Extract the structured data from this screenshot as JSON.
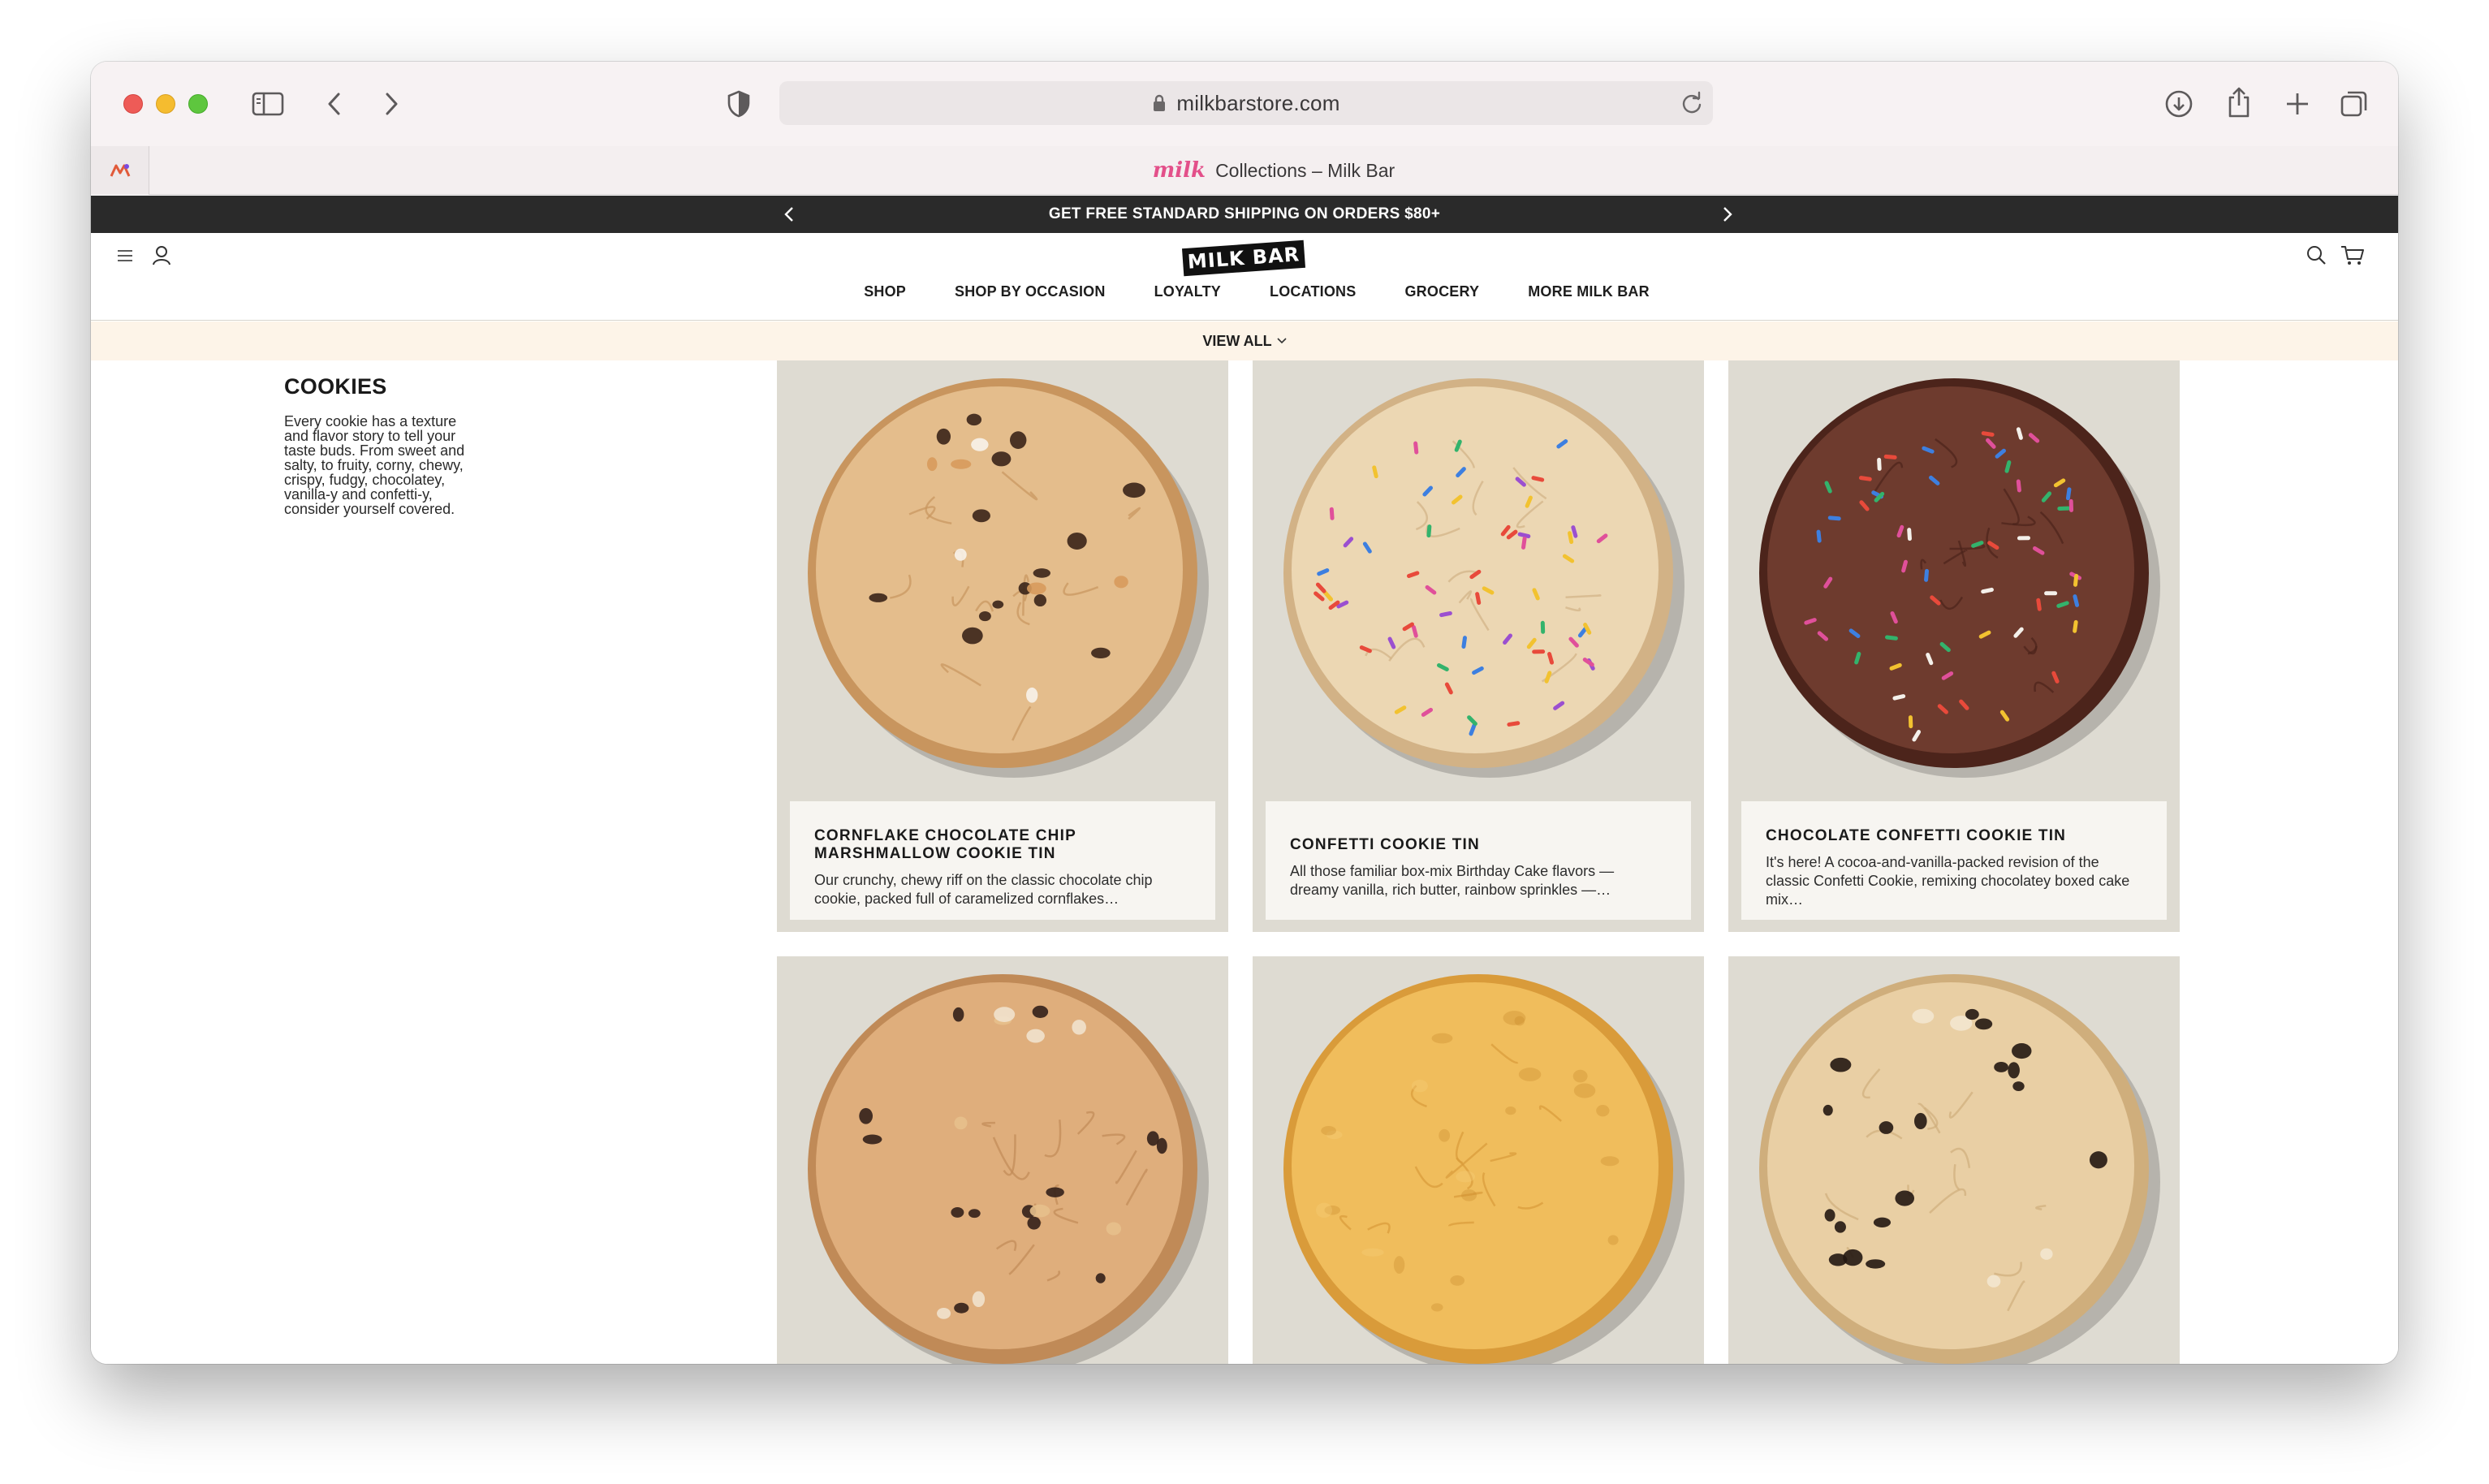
{
  "browser": {
    "url": "milkbarstore.com",
    "tab_title": "Collections – Milk Bar",
    "tab_favicon": "milk",
    "pinned_tab_icon": "app-favicon-icon"
  },
  "promo": {
    "text": "GET FREE STANDARD SHIPPING ON ORDERS $80+"
  },
  "header": {
    "logo": "MILK BAR",
    "nav": [
      {
        "label": "SHOP"
      },
      {
        "label": "SHOP BY OCCASION"
      },
      {
        "label": "LOYALTY"
      },
      {
        "label": "LOCATIONS"
      },
      {
        "label": "GROCERY"
      },
      {
        "label": "MORE MILK BAR"
      }
    ],
    "view_all": "VIEW ALL"
  },
  "category": {
    "title": "COOKIES",
    "description_lines": [
      "Every cookie has a texture",
      "and flavor story to tell your",
      "taste buds. From sweet and",
      "salty, to fruity, corny, chewy,",
      "crispy, fudgy, chocolatey,",
      "vanilla-y and confetti-y,",
      "consider yourself covered."
    ]
  },
  "products": [
    {
      "title_lines": [
        "CORNFLAKE CHOCOLATE CHIP",
        "MARSHMALLOW COOKIE TIN"
      ],
      "description_lines": [
        "Our crunchy, chewy riff on the classic chocolate chip",
        "cookie, packed full of caramelized cornflakes…"
      ],
      "cookie": {
        "base": "#e4bd8c",
        "edge": "#c8955e",
        "bits": "#3a2418",
        "accents": [
          "#f7f2ea",
          "#d79a5c"
        ]
      }
    },
    {
      "title_lines": [
        "CONFETTI COOKIE TIN"
      ],
      "description_lines": [
        "All those familiar box-mix Birthday Cake flavors —",
        "dreamy vanilla, rich butter, rainbow sprinkles —…"
      ],
      "cookie": {
        "base": "#ecd7b3",
        "edge": "#d2b286",
        "bits": "#e0509a",
        "accents": [
          "#33b36c",
          "#3d7fe0",
          "#f2c230",
          "#9b4fd0",
          "#e84a3b"
        ]
      }
    },
    {
      "title_lines": [
        "CHOCOLATE CONFETTI COOKIE TIN"
      ],
      "description_lines": [
        "It's here! A cocoa-and-vanilla-packed revision of the",
        "classic Confetti Cookie, remixing chocolatey boxed cake",
        "mix…"
      ],
      "cookie": {
        "base": "#6e3b2e",
        "edge": "#4c241b",
        "bits": "#f4f0ea",
        "accents": [
          "#33b36c",
          "#3d7fe0",
          "#f2c230",
          "#e0509a",
          "#e84a3b"
        ]
      }
    },
    {
      "title_lines": [],
      "description_lines": [],
      "cookie": {
        "base": "#dfae7c",
        "edge": "#c08a57",
        "bits": "#33201a",
        "accents": [
          "#f1e2cd",
          "#e7c08c"
        ]
      }
    },
    {
      "title_lines": [],
      "description_lines": [],
      "cookie": {
        "base": "#f0bd5c",
        "edge": "#d99b3a",
        "bits": "#c98a2c",
        "accents": [
          "#f6cf78"
        ]
      }
    },
    {
      "title_lines": [],
      "description_lines": [],
      "cookie": {
        "base": "#e9cfa4",
        "edge": "#cfae7c",
        "bits": "#241712",
        "accents": [
          "#f3e6cf"
        ]
      }
    }
  ]
}
